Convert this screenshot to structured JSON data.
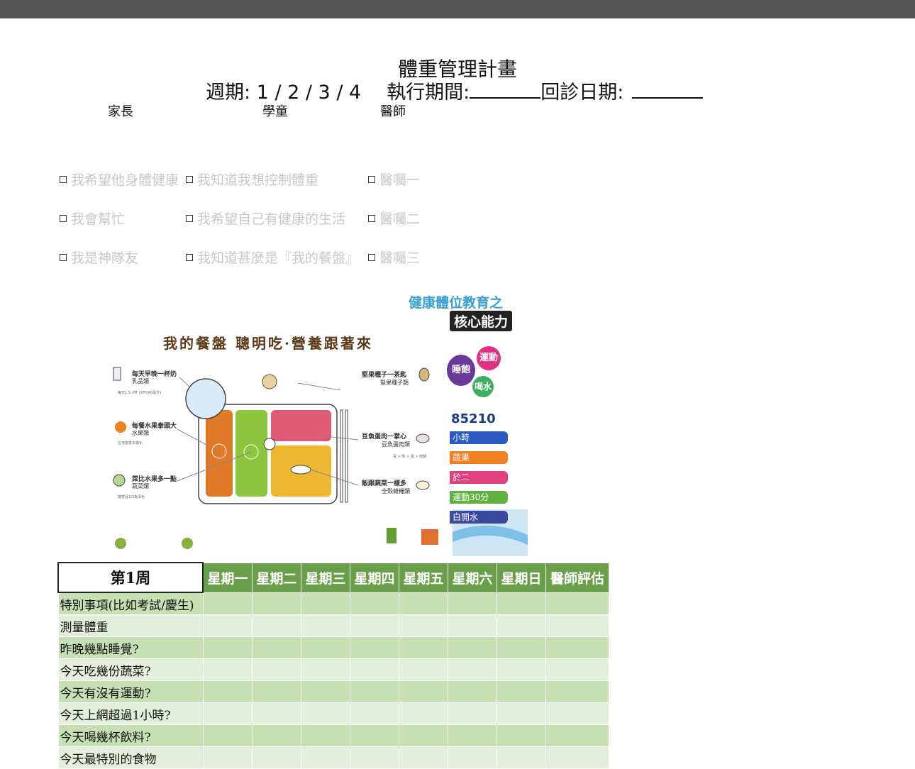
{
  "header": {
    "title": "體重管理計畫",
    "cycle_label": "週期: 1 / 2 / 3 / 4",
    "period_label": "執行期間:",
    "revisit_label": "回診日期:"
  },
  "roles": [
    "家長",
    "學童",
    "醫師"
  ],
  "checkboxes": {
    "parent": [
      "我希望他身體健康",
      "我會幫忙",
      "我是神隊友"
    ],
    "child": [
      "我知道我想控制體重",
      "我希望自己有健康的生活",
      "我知道甚麼是『我的餐盤』"
    ],
    "doctor": [
      "醫囑一",
      "醫囑二",
      "醫囑三"
    ]
  },
  "poster": {
    "plate_title": "我的餐盤 聰明吃·營養跟著來",
    "milk_head": "每天早晚一杯奶",
    "milk_type": "乳品類",
    "milk_note": "每天1.5-2杯\n(1杯240毫升)",
    "fruit_head": "每餐水果拳頭大",
    "fruit_type": "水果類",
    "fruit_note": "在地當季多樣化",
    "veg_head": "菜比水果多一點",
    "veg_type": "蔬菜類",
    "veg_note": "蔬菜且1/3為深色",
    "nut_head": "堅果種子一茶匙",
    "nut_type": "堅果種子類",
    "protein_head": "豆魚蛋肉一掌心",
    "protein_type": "豆魚蛋肉類",
    "protein_note": "豆 > 魚 > 蛋 > 肉類",
    "grain_head": "飯跟蔬菜一樣多",
    "grain_type": "全穀雜糧類",
    "side_title": "健康體位教育之",
    "side_core": "核心能力",
    "side_circles": [
      "運動",
      "睡飽",
      "喝水"
    ],
    "side_target": "85210",
    "side_bars": [
      "小時",
      "蔬果",
      "於二",
      "運動30分",
      "白開水"
    ]
  },
  "tracker": {
    "week_label": "第1周",
    "columns": [
      "星期一",
      "星期二",
      "星期三",
      "星期四",
      "星期五",
      "星期六",
      "星期日",
      "醫師評估"
    ],
    "rows": [
      "特別事項(比如考試/慶生)",
      "測量體重",
      "昨晚幾點睡覺?",
      "今天吃幾份蔬菜?",
      "今天有沒有運動?",
      "今天上網超過1小時?",
      "今天喝幾杯飲料?",
      "今天最特別的食物"
    ]
  },
  "colors": {
    "table_header": "#6a9f4a",
    "row_dark": "#c6dfb3",
    "row_light": "#e3efdc",
    "faded_text": "#c8c8c8"
  }
}
